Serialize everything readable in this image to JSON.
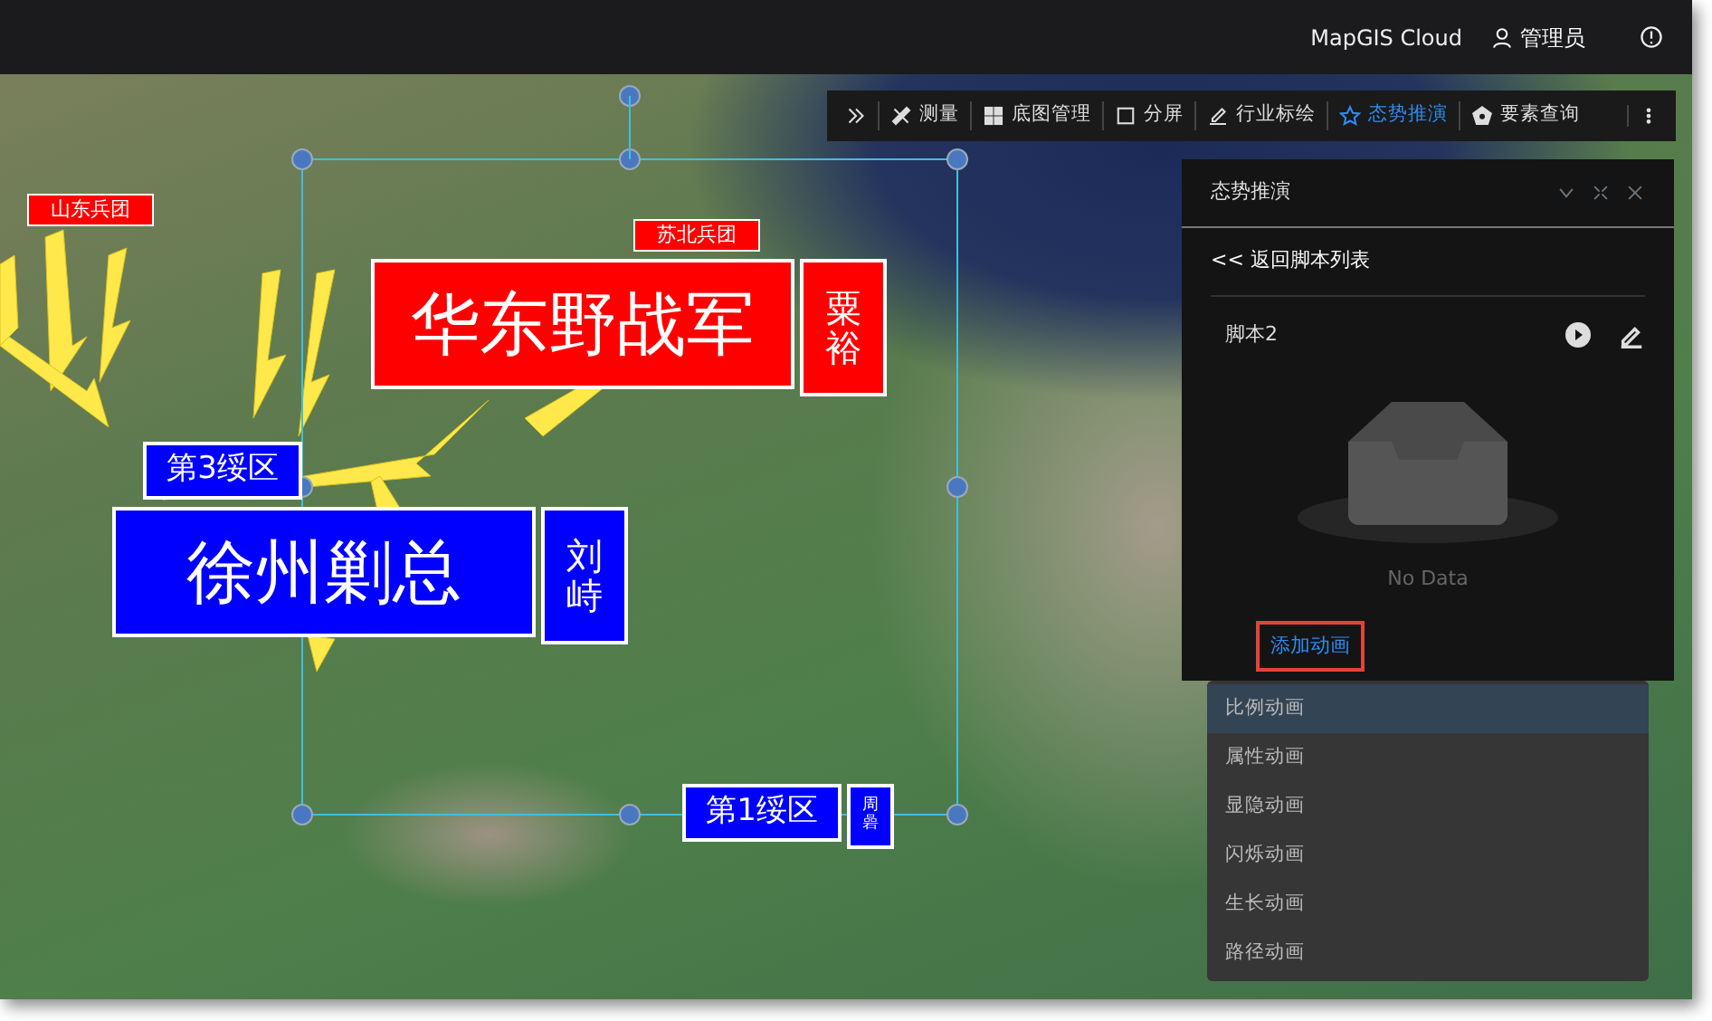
{
  "header": {
    "brand": "MapGIS Cloud",
    "user": "管理员"
  },
  "toolbar": {
    "items": [
      {
        "kind": "measure",
        "label": "测量",
        "selected": false
      },
      {
        "kind": "basemap",
        "label": "底图管理",
        "selected": false
      },
      {
        "kind": "split",
        "label": "分屏",
        "selected": false
      },
      {
        "kind": "plot",
        "label": "行业标绘",
        "selected": false
      },
      {
        "kind": "situation",
        "label": "态势推演",
        "selected": true
      },
      {
        "kind": "query",
        "label": "要素查询",
        "selected": false
      }
    ]
  },
  "map_labels": [
    {
      "text": "山东兵团",
      "color": "#ff0000",
      "kind": "small"
    },
    {
      "text": "苏北兵团",
      "color": "#ff0000",
      "kind": "small"
    },
    {
      "text": "华东野战军",
      "commander": "粟裕",
      "color": "#ff0000",
      "kind": "large"
    },
    {
      "text": "第3绥区",
      "color": "#0000ff",
      "kind": "medium"
    },
    {
      "text": "徐州剿总",
      "commander": "刘峙",
      "color": "#0000ff",
      "kind": "large"
    },
    {
      "text": "第1绥区",
      "commander": "周碞",
      "color": "#0000ff",
      "kind": "medium"
    }
  ],
  "panel": {
    "title": "态势推演",
    "back_link": "<< 返回脚本列表",
    "script_name": "脚本2",
    "empty_text": "No Data",
    "add_button": "添加动画"
  },
  "dropdown": {
    "items": [
      {
        "label": "比例动画",
        "selected": true
      },
      {
        "label": "属性动画",
        "selected": false
      },
      {
        "label": "显隐动画",
        "selected": false
      },
      {
        "label": "闪烁动画",
        "selected": false
      },
      {
        "label": "生长动画",
        "selected": false
      },
      {
        "label": "路径动画",
        "selected": false
      }
    ]
  }
}
